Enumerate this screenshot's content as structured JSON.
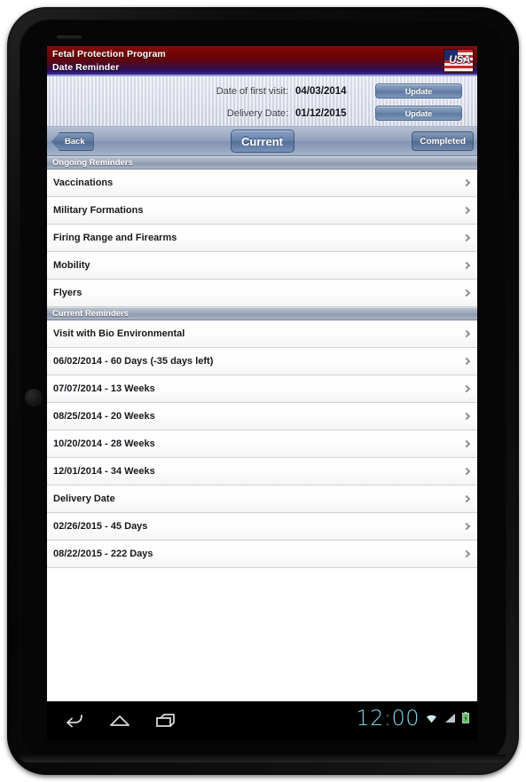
{
  "app": {
    "title_line1": "Fetal Protection Program",
    "title_line2": "Date Reminder",
    "logo_name": "usa-flag-logo",
    "logo_text": "USA",
    "header_gradient_top": "#7a0606",
    "header_gradient_bottom": "#3a2b8e"
  },
  "info_panel": {
    "rows": [
      {
        "label": "Date of first visit:",
        "value": "04/03/2014",
        "button": "Update"
      },
      {
        "label": "Delivery Date:",
        "value": "01/12/2015",
        "button": "Update"
      }
    ]
  },
  "toolbar": {
    "back_label": "Back",
    "current_label": "Current",
    "completed_label": "Completed",
    "accent": "#5d789f"
  },
  "sections": [
    {
      "header": "Ongoing Reminders",
      "rows": [
        {
          "label": "Vaccinations"
        },
        {
          "label": "Military Formations"
        },
        {
          "label": "Firing Range and Firearms"
        },
        {
          "label": "Mobility"
        },
        {
          "label": "Flyers"
        }
      ]
    },
    {
      "header": "Current Reminders",
      "rows": [
        {
          "label": "Visit with Bio Environmental"
        },
        {
          "label": "06/02/2014 - 60 Days (-35 days left)"
        },
        {
          "label": "07/07/2014 - 13 Weeks"
        },
        {
          "label": "08/25/2014 - 20 Weeks"
        },
        {
          "label": "10/20/2014 - 28 Weeks"
        },
        {
          "label": "12/01/2014 - 34 Weeks"
        },
        {
          "label": "Delivery Date"
        },
        {
          "label": "02/26/2015 - 45 Days"
        },
        {
          "label": "08/22/2015 - 222 Days"
        }
      ]
    }
  ],
  "system_bar": {
    "clock": "12:00",
    "clock_color": "#7fd3e8",
    "nav_buttons": [
      "back-icon",
      "home-icon",
      "recents-icon"
    ],
    "status_icons": [
      "wifi-icon",
      "signal-icon",
      "battery-icon"
    ]
  }
}
